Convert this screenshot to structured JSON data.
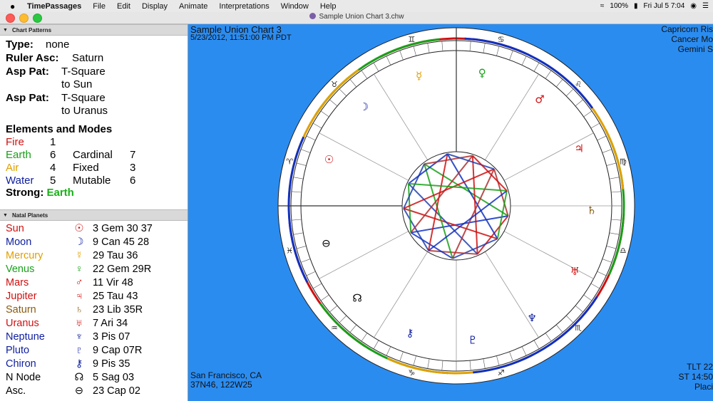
{
  "menubar": {
    "apple": "",
    "app": "TimePassages",
    "items": [
      "File",
      "Edit",
      "Display",
      "Animate",
      "Interpretations",
      "Window",
      "Help"
    ],
    "battery": "100%",
    "clock": "Fri Jul 5  7:04"
  },
  "window": {
    "title": "Sample Union Chart 3.chw"
  },
  "patterns": {
    "header": "Chart Patterns",
    "type_label": "Type:",
    "type_value": "none",
    "ruler_label": "Ruler Asc:",
    "ruler_value": "Saturn",
    "asp1_label": "Asp Pat:",
    "asp1_l1": "T-Square",
    "asp1_l2": "to Sun",
    "asp2_label": "Asp Pat:",
    "asp2_l1": "T-Square",
    "asp2_l2": "to Uranus",
    "elements_title": "Elements and Modes",
    "elements": [
      {
        "name": "Fire",
        "count": "1",
        "mode": "",
        "mcount": "",
        "color": "#d01010"
      },
      {
        "name": "Earth",
        "count": "6",
        "mode": "Cardinal",
        "mcount": "7",
        "color": "#18a018"
      },
      {
        "name": "Air",
        "count": "4",
        "mode": "Fixed",
        "mcount": "3",
        "color": "#e0a000"
      },
      {
        "name": "Water",
        "count": "5",
        "mode": "Mutable",
        "mcount": "6",
        "color": "#1020a0"
      }
    ],
    "strong_label": "Strong:",
    "strong_value": "Earth",
    "strong_color": "#18b018"
  },
  "natal": {
    "header": "Natal Planets",
    "planets": [
      {
        "name": "Sun",
        "glyph": "☉",
        "pos": "3 Gem 30 37",
        "color": "#d01010"
      },
      {
        "name": "Moon",
        "glyph": "☽",
        "pos": "9 Can 45 28",
        "color": "#1020a0"
      },
      {
        "name": "Mercury",
        "glyph": "☿",
        "pos": "29 Tau 36",
        "color": "#e0a000"
      },
      {
        "name": "Venus",
        "glyph": "♀",
        "pos": "22 Gem 29R",
        "color": "#18a018"
      },
      {
        "name": "Mars",
        "glyph": "♂",
        "pos": "11 Vir 48",
        "color": "#d01010"
      },
      {
        "name": "Jupiter",
        "glyph": "♃",
        "pos": "25 Tau 43",
        "color": "#d01010"
      },
      {
        "name": "Saturn",
        "glyph": "♄",
        "pos": "23 Lib 35R",
        "color": "#8a5a10"
      },
      {
        "name": "Uranus",
        "glyph": "♅",
        "pos": "7 Ari 34",
        "color": "#d01010"
      },
      {
        "name": "Neptune",
        "glyph": "♆",
        "pos": "3 Pis 07",
        "color": "#1020a0"
      },
      {
        "name": "Pluto",
        "glyph": "♇",
        "pos": "9 Cap 07R",
        "color": "#1020a0"
      },
      {
        "name": "Chiron",
        "glyph": "⚷",
        "pos": "9 Pis 35",
        "color": "#1020a0"
      },
      {
        "name": "N Node",
        "glyph": "☊",
        "pos": "5 Sag 03",
        "color": "#000000"
      },
      {
        "name": "Asc.",
        "glyph": "⊖",
        "pos": "23 Cap 02",
        "color": "#000000"
      }
    ]
  },
  "chart": {
    "title": "Sample Union Chart 3",
    "datetime": "5/23/2012, 11:51:00 PM PDT",
    "right_top": [
      "Capricorn Ris",
      "Cancer Mo",
      "Gemini S"
    ],
    "location": "San Francisco, CA",
    "coords": "37N46, 122W25",
    "right_bottom": [
      "TLT 22",
      "ST 14:50",
      "Placi"
    ]
  }
}
